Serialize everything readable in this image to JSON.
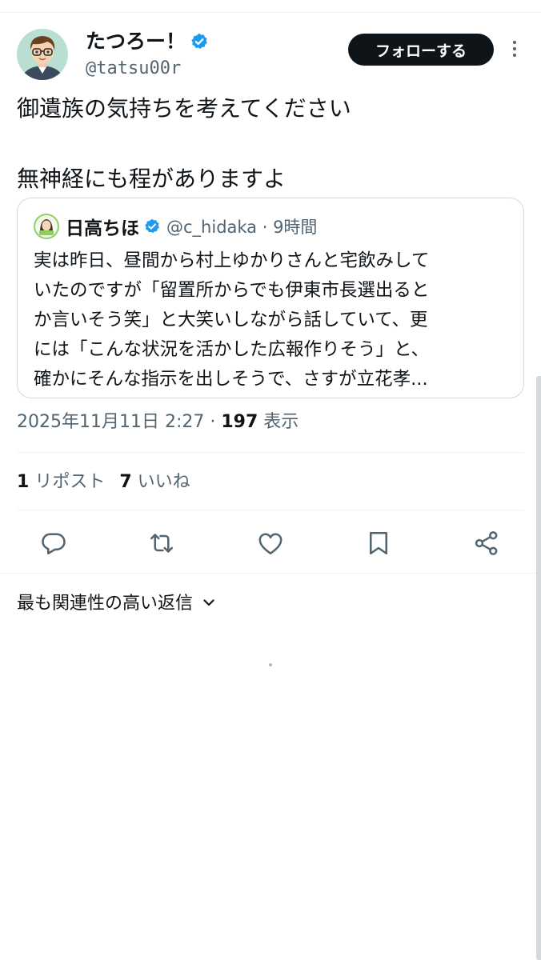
{
  "author": {
    "name": "たつろー！",
    "handle": "@tatsu00r",
    "follow_label": "フォローする"
  },
  "tweet": {
    "line1": "御遺族の気持ちを考えてください",
    "line2": "無神経にも程がありますよ"
  },
  "quote": {
    "name": "日高ちほ",
    "meta": "@c_hidaka · 9時間",
    "lines": [
      "実は昨日、昼間から村上ゆかりさんと宅飲みして",
      "いたのですが「留置所からでも伊東市長選出ると",
      "か言いそう笑」と大笑いしながら話していて、更",
      "には「こんな状況を活かした広報作りそう」と、",
      "確かにそんな指示を出しそうで、さすが立花孝..."
    ]
  },
  "timestamp": {
    "date": "2025年11月11日 2:27 · ",
    "views_count": "197",
    "views_label": " 表示"
  },
  "stats": {
    "reposts_count": "1",
    "reposts_label": "リポスト",
    "likes_count": "7",
    "likes_label": "いいね"
  },
  "actions": [
    "reply-icon",
    "repost-icon",
    "like-icon",
    "bookmark-icon",
    "share-icon"
  ],
  "replies": {
    "sort_label": "最も関連性の高い返信"
  },
  "colors": {
    "accent": "#1d9bf0",
    "text": "#0f1419",
    "secondary": "#536471",
    "border": "#cfd9de"
  }
}
